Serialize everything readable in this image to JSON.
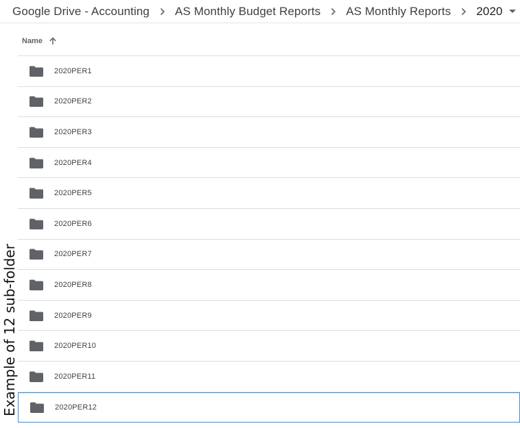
{
  "breadcrumb": {
    "items": [
      {
        "label": "Google Drive - Accounting"
      },
      {
        "label": "AS Monthly Budget Reports"
      },
      {
        "label": "AS Monthly Reports"
      },
      {
        "label": "2020"
      }
    ],
    "separator_icon": "chevron-right-icon",
    "dropdown_icon": "caret-down-icon"
  },
  "list": {
    "column_name": "Name",
    "sort_icon": "arrow-up-icon",
    "folder_icon": "folder-icon",
    "folder_color": "#5f6368",
    "selected_border_color": "#4a88c2",
    "rows": [
      {
        "name": "2020PER1"
      },
      {
        "name": "2020PER2"
      },
      {
        "name": "2020PER3"
      },
      {
        "name": "2020PER4"
      },
      {
        "name": "2020PER5"
      },
      {
        "name": "2020PER6"
      },
      {
        "name": "2020PER7"
      },
      {
        "name": "2020PER8"
      },
      {
        "name": "2020PER9"
      },
      {
        "name": "2020PER10"
      },
      {
        "name": "2020PER11"
      },
      {
        "name": "2020PER12"
      }
    ]
  },
  "annotation": {
    "text": "Example of 12 sub-folder"
  }
}
